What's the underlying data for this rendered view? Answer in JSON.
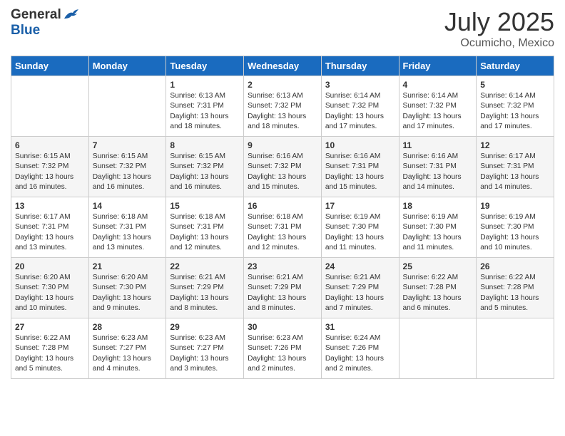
{
  "header": {
    "logo_general": "General",
    "logo_blue": "Blue",
    "month": "July 2025",
    "location": "Ocumicho, Mexico"
  },
  "days_of_week": [
    "Sunday",
    "Monday",
    "Tuesday",
    "Wednesday",
    "Thursday",
    "Friday",
    "Saturday"
  ],
  "weeks": [
    [
      {
        "day": "",
        "info": ""
      },
      {
        "day": "",
        "info": ""
      },
      {
        "day": "1",
        "info": "Sunrise: 6:13 AM\nSunset: 7:31 PM\nDaylight: 13 hours and 18 minutes."
      },
      {
        "day": "2",
        "info": "Sunrise: 6:13 AM\nSunset: 7:32 PM\nDaylight: 13 hours and 18 minutes."
      },
      {
        "day": "3",
        "info": "Sunrise: 6:14 AM\nSunset: 7:32 PM\nDaylight: 13 hours and 17 minutes."
      },
      {
        "day": "4",
        "info": "Sunrise: 6:14 AM\nSunset: 7:32 PM\nDaylight: 13 hours and 17 minutes."
      },
      {
        "day": "5",
        "info": "Sunrise: 6:14 AM\nSunset: 7:32 PM\nDaylight: 13 hours and 17 minutes."
      }
    ],
    [
      {
        "day": "6",
        "info": "Sunrise: 6:15 AM\nSunset: 7:32 PM\nDaylight: 13 hours and 16 minutes."
      },
      {
        "day": "7",
        "info": "Sunrise: 6:15 AM\nSunset: 7:32 PM\nDaylight: 13 hours and 16 minutes."
      },
      {
        "day": "8",
        "info": "Sunrise: 6:15 AM\nSunset: 7:32 PM\nDaylight: 13 hours and 16 minutes."
      },
      {
        "day": "9",
        "info": "Sunrise: 6:16 AM\nSunset: 7:32 PM\nDaylight: 13 hours and 15 minutes."
      },
      {
        "day": "10",
        "info": "Sunrise: 6:16 AM\nSunset: 7:31 PM\nDaylight: 13 hours and 15 minutes."
      },
      {
        "day": "11",
        "info": "Sunrise: 6:16 AM\nSunset: 7:31 PM\nDaylight: 13 hours and 14 minutes."
      },
      {
        "day": "12",
        "info": "Sunrise: 6:17 AM\nSunset: 7:31 PM\nDaylight: 13 hours and 14 minutes."
      }
    ],
    [
      {
        "day": "13",
        "info": "Sunrise: 6:17 AM\nSunset: 7:31 PM\nDaylight: 13 hours and 13 minutes."
      },
      {
        "day": "14",
        "info": "Sunrise: 6:18 AM\nSunset: 7:31 PM\nDaylight: 13 hours and 13 minutes."
      },
      {
        "day": "15",
        "info": "Sunrise: 6:18 AM\nSunset: 7:31 PM\nDaylight: 13 hours and 12 minutes."
      },
      {
        "day": "16",
        "info": "Sunrise: 6:18 AM\nSunset: 7:31 PM\nDaylight: 13 hours and 12 minutes."
      },
      {
        "day": "17",
        "info": "Sunrise: 6:19 AM\nSunset: 7:30 PM\nDaylight: 13 hours and 11 minutes."
      },
      {
        "day": "18",
        "info": "Sunrise: 6:19 AM\nSunset: 7:30 PM\nDaylight: 13 hours and 11 minutes."
      },
      {
        "day": "19",
        "info": "Sunrise: 6:19 AM\nSunset: 7:30 PM\nDaylight: 13 hours and 10 minutes."
      }
    ],
    [
      {
        "day": "20",
        "info": "Sunrise: 6:20 AM\nSunset: 7:30 PM\nDaylight: 13 hours and 10 minutes."
      },
      {
        "day": "21",
        "info": "Sunrise: 6:20 AM\nSunset: 7:30 PM\nDaylight: 13 hours and 9 minutes."
      },
      {
        "day": "22",
        "info": "Sunrise: 6:21 AM\nSunset: 7:29 PM\nDaylight: 13 hours and 8 minutes."
      },
      {
        "day": "23",
        "info": "Sunrise: 6:21 AM\nSunset: 7:29 PM\nDaylight: 13 hours and 8 minutes."
      },
      {
        "day": "24",
        "info": "Sunrise: 6:21 AM\nSunset: 7:29 PM\nDaylight: 13 hours and 7 minutes."
      },
      {
        "day": "25",
        "info": "Sunrise: 6:22 AM\nSunset: 7:28 PM\nDaylight: 13 hours and 6 minutes."
      },
      {
        "day": "26",
        "info": "Sunrise: 6:22 AM\nSunset: 7:28 PM\nDaylight: 13 hours and 5 minutes."
      }
    ],
    [
      {
        "day": "27",
        "info": "Sunrise: 6:22 AM\nSunset: 7:28 PM\nDaylight: 13 hours and 5 minutes."
      },
      {
        "day": "28",
        "info": "Sunrise: 6:23 AM\nSunset: 7:27 PM\nDaylight: 13 hours and 4 minutes."
      },
      {
        "day": "29",
        "info": "Sunrise: 6:23 AM\nSunset: 7:27 PM\nDaylight: 13 hours and 3 minutes."
      },
      {
        "day": "30",
        "info": "Sunrise: 6:23 AM\nSunset: 7:26 PM\nDaylight: 13 hours and 2 minutes."
      },
      {
        "day": "31",
        "info": "Sunrise: 6:24 AM\nSunset: 7:26 PM\nDaylight: 13 hours and 2 minutes."
      },
      {
        "day": "",
        "info": ""
      },
      {
        "day": "",
        "info": ""
      }
    ]
  ]
}
